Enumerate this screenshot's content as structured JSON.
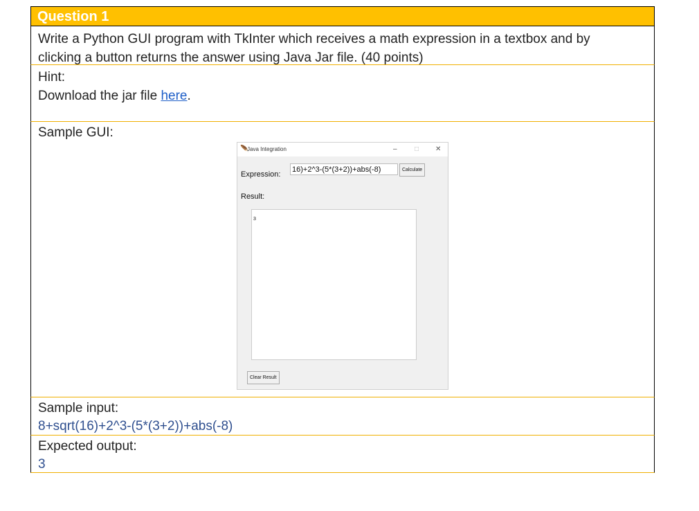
{
  "question": {
    "title": "Question 1",
    "text_line1": "Write a Python GUI program with TkInter which receives a math expression in a textbox and by",
    "text_line2": "clicking a button returns the answer using Java Jar file. (40 points)"
  },
  "hint": {
    "label": "Hint:",
    "download_prefix": "Download the jar file ",
    "link_text": "here",
    "suffix": "."
  },
  "sample_gui": {
    "label": "Sample GUI:",
    "window": {
      "title": "Java Integration",
      "minimize": "–",
      "maximize": "□",
      "close": "✕",
      "expression_label": "Expression:",
      "expression_value": "16)+2^3-(5*(3+2))+abs(-8)",
      "calculate_label": "Calculate",
      "result_label": "Result:",
      "result_value": "3",
      "clear_label": "Clear Result"
    }
  },
  "sample_input": {
    "label": "Sample input:",
    "value": "8+sqrt(16)+2^3-(5*(3+2))+abs(-8)"
  },
  "expected_output": {
    "label": "Expected output:",
    "value": "3"
  }
}
